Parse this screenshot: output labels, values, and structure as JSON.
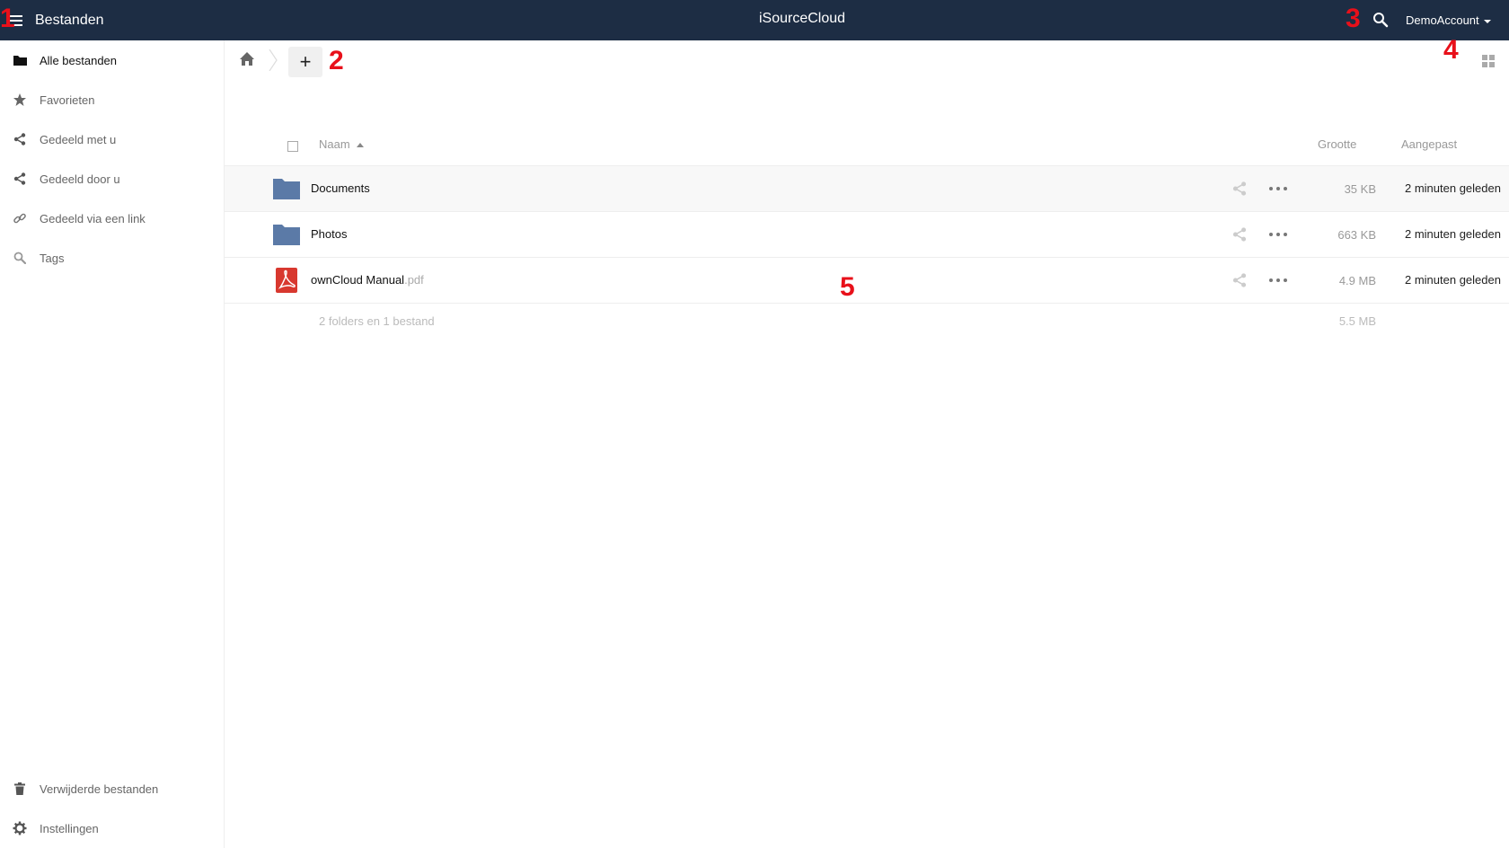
{
  "topbar": {
    "app_name": "Bestanden",
    "brand": "iSourceCloud",
    "user_name": "DemoAccount"
  },
  "sidebar": {
    "items": [
      {
        "label": "Alle bestanden",
        "icon": "folder-icon"
      },
      {
        "label": "Favorieten",
        "icon": "star-icon"
      },
      {
        "label": "Gedeeld met u",
        "icon": "share-icon"
      },
      {
        "label": "Gedeeld door u",
        "icon": "share-icon"
      },
      {
        "label": "Gedeeld via een link",
        "icon": "link-icon"
      },
      {
        "label": "Tags",
        "icon": "search-icon"
      }
    ],
    "footer": [
      {
        "label": "Verwijderde bestanden",
        "icon": "trash-icon"
      },
      {
        "label": "Instellingen",
        "icon": "gear-icon"
      }
    ]
  },
  "table": {
    "columns": {
      "name": "Naam",
      "size": "Grootte",
      "modified": "Aangepast"
    },
    "rows": [
      {
        "name": "Documents",
        "ext": "",
        "type": "folder",
        "size": "35 KB",
        "modified": "2 minuten geleden"
      },
      {
        "name": "Photos",
        "ext": "",
        "type": "folder",
        "size": "663 KB",
        "modified": "2 minuten geleden"
      },
      {
        "name": "ownCloud Manual",
        "ext": ".pdf",
        "type": "pdf",
        "size": "4.9 MB",
        "modified": "2 minuten geleden"
      }
    ],
    "summary": {
      "text": "2 folders en 1 bestand",
      "size": "5.5 MB"
    }
  },
  "annotations": [
    "1",
    "2",
    "3",
    "4",
    "5"
  ],
  "colors": {
    "topbar": "#1d2d44",
    "folder": "#5b7aa7",
    "pdf": "#d8382f",
    "marker": "#e8101a"
  }
}
